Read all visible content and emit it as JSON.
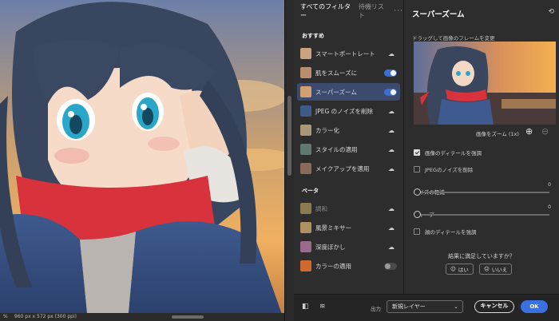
{
  "canvas": {
    "status_zoom": "%",
    "status_text": "960 px x 572 px (300 ppi)"
  },
  "filters_panel": {
    "tabs": [
      "すべてのフィルター",
      "待機リスト"
    ],
    "more_icon": "more-icon",
    "sections": [
      {
        "heading": "おすすめ",
        "items": [
          {
            "label": "スマートポートレート",
            "state": "cloud",
            "thumb": "#c9a27e"
          },
          {
            "label": "肌をスムーズに",
            "state": "on",
            "thumb": "#b88d70"
          },
          {
            "label": "スーパーズーム",
            "state": "on",
            "thumb": "#d0a070",
            "active": true
          },
          {
            "label": "JPEG のノイズを削除",
            "state": "cloud",
            "thumb": "#3d5a8a"
          },
          {
            "label": "カラー化",
            "state": "cloud",
            "thumb": "#a89878"
          },
          {
            "label": "スタイルの適用",
            "state": "cloud",
            "thumb": "#5e7a70"
          },
          {
            "label": "メイクアップを適用",
            "state": "cloud",
            "thumb": "#8a6a5a"
          }
        ]
      },
      {
        "heading": "ベータ",
        "items": [
          {
            "label": "調和",
            "state": "cloud",
            "thumb": "#8a7a50",
            "dim": true
          },
          {
            "label": "風景ミキサー",
            "state": "cloud",
            "thumb": "#b09060"
          },
          {
            "label": "深度ぼかし",
            "state": "cloud",
            "thumb": "#9a6a8a"
          },
          {
            "label": "カラーの適用",
            "state": "off",
            "thumb": "#d06a30"
          }
        ]
      }
    ]
  },
  "settings_panel": {
    "title": "スーパーズーム",
    "hint": "ドラッグして画像のフレームを変更",
    "zoom_label": "画像をズーム (1x)",
    "checkboxes": [
      {
        "label": "画像のディテールを強調",
        "checked": true
      },
      {
        "label": "JPEGのノイズを削除",
        "checked": false
      }
    ],
    "sliders": [
      {
        "label": "ノイズの軽減",
        "value": "0"
      },
      {
        "label": "シャープ",
        "value": "0"
      }
    ],
    "face_checkbox": {
      "label": "顔のディテールを強調",
      "checked": false
    },
    "feedback_question": "結果に満足していますか？",
    "yes_label": "はい",
    "no_label": "いいえ"
  },
  "footer": {
    "output_label": "出力",
    "output_value": "新規レイヤー",
    "cancel_label": "キャンセル",
    "ok_label": "OK"
  },
  "colors": {
    "accent": "#3a70e0",
    "panel_bg": "#2d2d2d",
    "active_item": "#3c4a6e"
  }
}
